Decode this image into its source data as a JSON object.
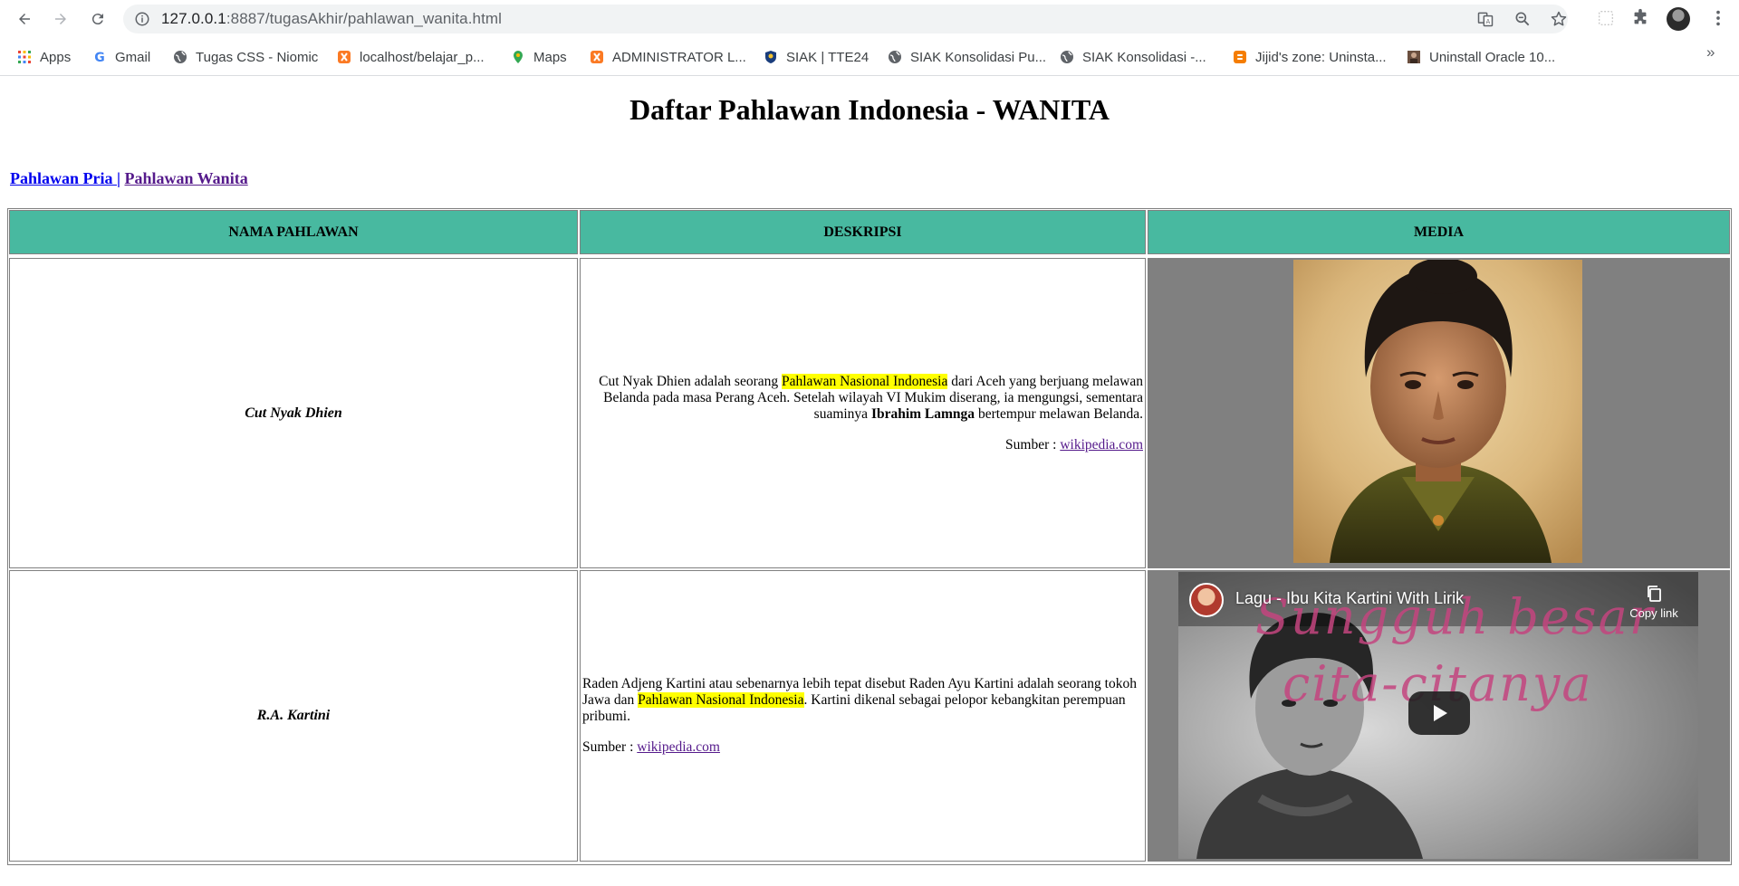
{
  "browser": {
    "url_host": "127.0.0.1",
    "url_path": ":8887/tugasAkhir/pahlawan_wanita.html",
    "bookmarks": [
      {
        "label": "Apps",
        "icon": "apps-grid-icon"
      },
      {
        "label": "Gmail",
        "icon": "google-icon"
      },
      {
        "label": "Tugas CSS - Niomic",
        "icon": "globe-icon"
      },
      {
        "label": "localhost/belajar_p...",
        "icon": "xampp-icon"
      },
      {
        "label": "Maps",
        "icon": "maps-pin-icon"
      },
      {
        "label": "ADMINISTRATOR L...",
        "icon": "xampp-icon"
      },
      {
        "label": "SIAK | TTE24",
        "icon": "shield-emblem-icon"
      },
      {
        "label": "SIAK Konsolidasi Pu...",
        "icon": "globe-icon"
      },
      {
        "label": "SIAK Konsolidasi -...",
        "icon": "globe-icon"
      },
      {
        "label": "Jijid's zone: Uninsta...",
        "icon": "blogger-icon"
      },
      {
        "label": "Uninstall Oracle 10...",
        "icon": "photo-thumb-icon"
      }
    ],
    "more_label": "»"
  },
  "page": {
    "title": "Daftar Pahlawan Indonesia - WANITA",
    "nav": {
      "pria": "Pahlawan Pria ",
      "separator": "|",
      "wanita": "Pahlawan Wanita"
    },
    "table": {
      "headers": [
        "NAMA PAHLAWAN",
        "DESKRIPSI",
        "MEDIA"
      ],
      "rows": [
        {
          "name": "Cut Nyak Dhien",
          "desc_before": "Cut Nyak Dhien adalah seorang ",
          "desc_mark": "Pahlawan Nasional Indonesia",
          "desc_mid": " dari Aceh yang berjuang melawan Belanda pada masa Perang Aceh. Setelah wilayah VI Mukim diserang, ia mengungsi, sementara suaminya ",
          "desc_bold": "Ibrahim Lamnga",
          "desc_after": " bertempur melawan Belanda.",
          "source_label": "Sumber : ",
          "source_link": "wikipedia.com",
          "media": "portrait"
        },
        {
          "name": "R.A. Kartini",
          "desc_before": "Raden Adjeng Kartini atau sebenarnya lebih tepat disebut Raden Ayu Kartini adalah seorang tokoh Jawa dan ",
          "desc_mark": "Pahlawan Nasional Indonesia",
          "desc_after": ". Kartini dikenal sebagai pelopor kebangkitan perempuan pribumi.",
          "source_label": "Sumber : ",
          "source_link": "wikipedia.com",
          "media": {
            "video_title": "Lagu - Ibu Kita Kartini With Lirik",
            "copy_link": "Copy link",
            "lyric_line1": "Sungguh besar",
            "lyric_line2": "cita-citanya"
          }
        }
      ]
    }
  }
}
